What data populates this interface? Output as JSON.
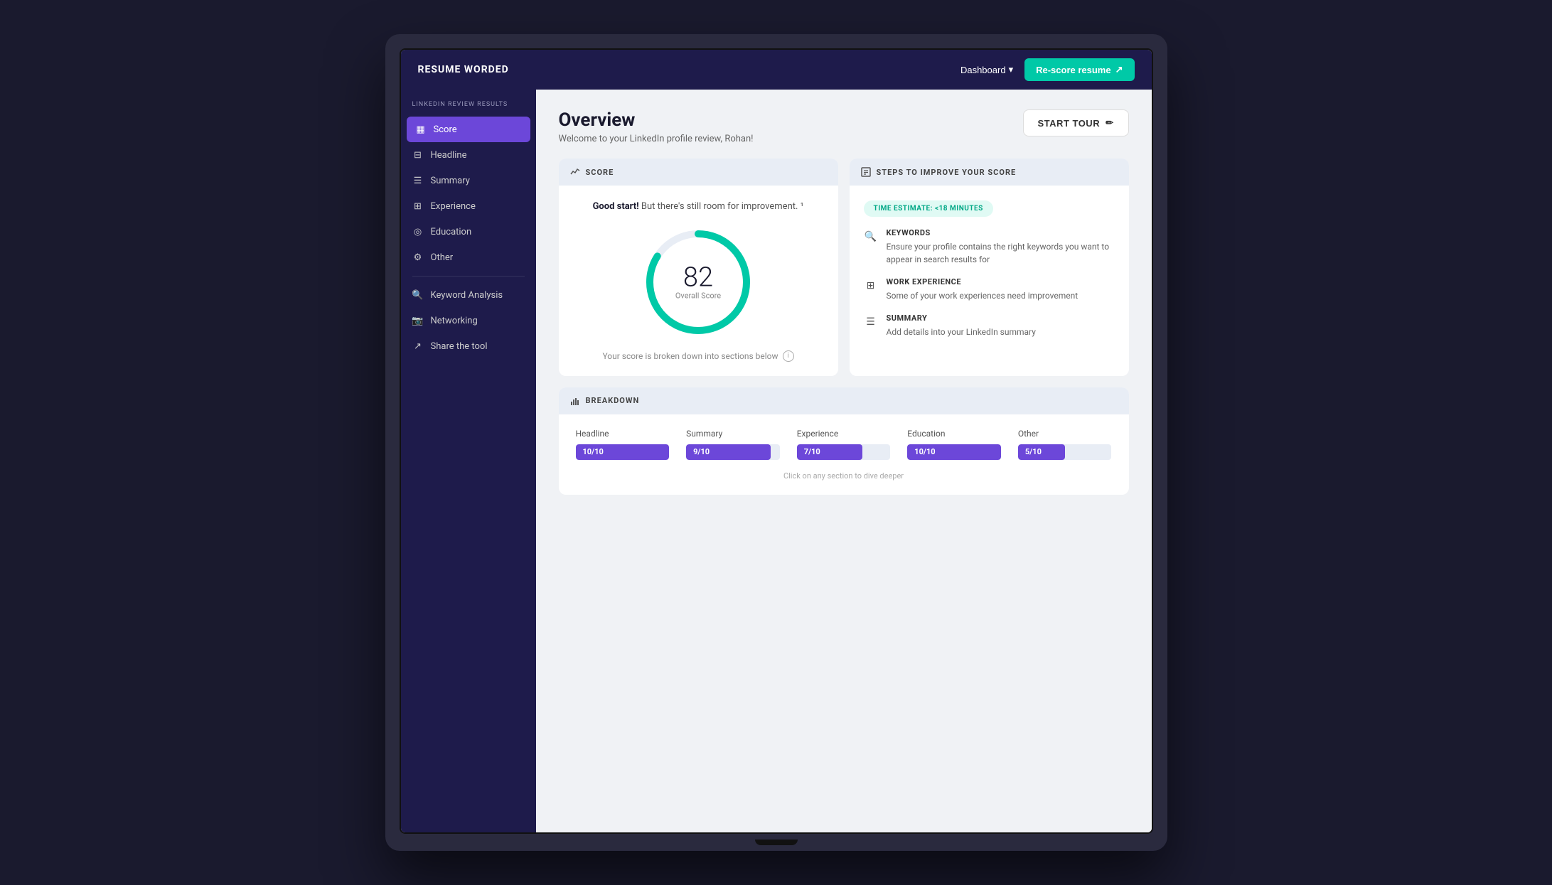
{
  "brand": {
    "name": "RESUME WORDED",
    "subtitle": "LINKEDIN REVIEW RESULTS"
  },
  "topnav": {
    "dashboard_label": "Dashboard",
    "rescore_label": "Re-score resume",
    "chevron": "▾",
    "rescore_icon": "↗"
  },
  "sidebar": {
    "items": [
      {
        "id": "score",
        "label": "Score",
        "icon": "▦",
        "active": true
      },
      {
        "id": "headline",
        "label": "Headline",
        "icon": "⊟"
      },
      {
        "id": "summary",
        "label": "Summary",
        "icon": "☰"
      },
      {
        "id": "experience",
        "label": "Experience",
        "icon": "⊞"
      },
      {
        "id": "education",
        "label": "Education",
        "icon": "◎"
      },
      {
        "id": "other",
        "label": "Other",
        "icon": "⚙"
      },
      {
        "id": "keyword-analysis",
        "label": "Keyword Analysis",
        "icon": "🔍"
      },
      {
        "id": "networking",
        "label": "Networking",
        "icon": "📷"
      },
      {
        "id": "share-the-tool",
        "label": "Share the tool",
        "icon": "↗"
      }
    ]
  },
  "page": {
    "title": "Overview",
    "subtitle": "Welcome to your LinkedIn profile review, Rohan!",
    "start_tour_label": "START TOUR",
    "start_tour_icon": "✏"
  },
  "score_card": {
    "header": "SCORE",
    "intro_bold": "Good start!",
    "intro_rest": " But there's still room for improvement. ¹",
    "score_value": "82",
    "score_label": "Overall Score",
    "footer": "Your score is broken down into sections below",
    "circle_percent": 82
  },
  "steps_card": {
    "header": "STEPS TO IMPROVE YOUR SCORE",
    "time_badge": "TIME ESTIMATE: <18 MINUTES",
    "steps": [
      {
        "icon": "🔍",
        "title": "KEYWORDS",
        "desc": "Ensure your profile contains the right keywords you want to appear in search results for"
      },
      {
        "icon": "⊞",
        "title": "WORK EXPERIENCE",
        "desc": "Some of your work experiences need improvement"
      },
      {
        "icon": "☰",
        "title": "SUMMARY",
        "desc": "Add details into your LinkedIn summary"
      }
    ]
  },
  "breakdown_card": {
    "header": "BREAKDOWN",
    "items": [
      {
        "label": "Headline",
        "score": "10/10",
        "percent": 100
      },
      {
        "label": "Summary",
        "score": "9/10",
        "percent": 90
      },
      {
        "label": "Experience",
        "score": "7/10",
        "percent": 70
      },
      {
        "label": "Education",
        "score": "10/10",
        "percent": 100
      },
      {
        "label": "Other",
        "score": "5/10",
        "percent": 50
      }
    ],
    "footer": "Click on any section to dive deeper"
  }
}
